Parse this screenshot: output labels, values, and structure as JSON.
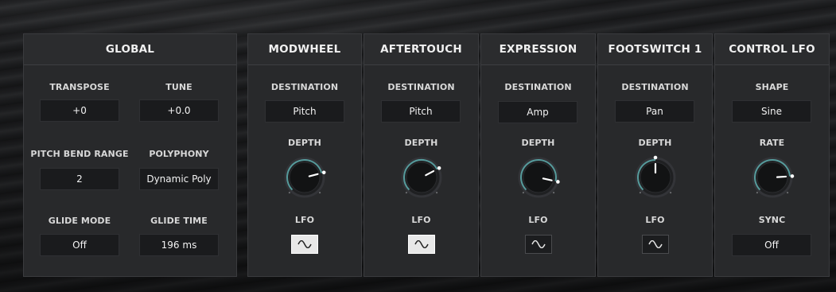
{
  "global": {
    "title": "GLOBAL",
    "transpose": {
      "label": "TRANSPOSE",
      "value": "+0"
    },
    "tune": {
      "label": "TUNE",
      "value": "+0.0"
    },
    "pitch_bend_range": {
      "label": "PITCH BEND RANGE",
      "value": "2"
    },
    "polyphony": {
      "label": "POLYPHONY",
      "value": "Dynamic Poly"
    },
    "glide_mode": {
      "label": "GLIDE MODE",
      "value": "Off"
    },
    "glide_time": {
      "label": "GLIDE TIME",
      "value": "196 ms"
    }
  },
  "modwheel": {
    "title": "MODWHEEL",
    "destination_label": "DESTINATION",
    "destination": "Pitch",
    "depth_label": "DEPTH",
    "depth": 0.78,
    "lfo_label": "LFO",
    "lfo_on": true,
    "lfo_icon": "sine-wave-icon"
  },
  "aftertouch": {
    "title": "AFTERTOUCH",
    "destination_label": "DESTINATION",
    "destination": "Pitch",
    "depth_label": "DEPTH",
    "depth": 0.73,
    "lfo_label": "LFO",
    "lfo_on": true,
    "lfo_icon": "sine-wave-icon"
  },
  "expression": {
    "title": "EXPRESSION",
    "destination_label": "DESTINATION",
    "destination": "Amp",
    "depth_label": "DEPTH",
    "depth": 0.88,
    "lfo_label": "LFO",
    "lfo_on": false,
    "lfo_icon": "sine-wave-icon"
  },
  "footswitch1": {
    "title": "FOOTSWITCH 1",
    "destination_label": "DESTINATION",
    "destination": "Pan",
    "depth_label": "DEPTH",
    "depth": 0.5,
    "lfo_label": "LFO",
    "lfo_on": false,
    "lfo_icon": "sine-wave-icon"
  },
  "control_lfo": {
    "title": "CONTROL LFO",
    "shape_label": "SHAPE",
    "shape": "Sine",
    "rate_label": "RATE",
    "rate": 0.82,
    "sync_label": "SYNC",
    "sync": "Off"
  },
  "colors": {
    "knob_arc": "#5fb0b0",
    "panel": "#28292b",
    "field": "#1a1b1d",
    "lfo_on": "#e8e8e8"
  }
}
